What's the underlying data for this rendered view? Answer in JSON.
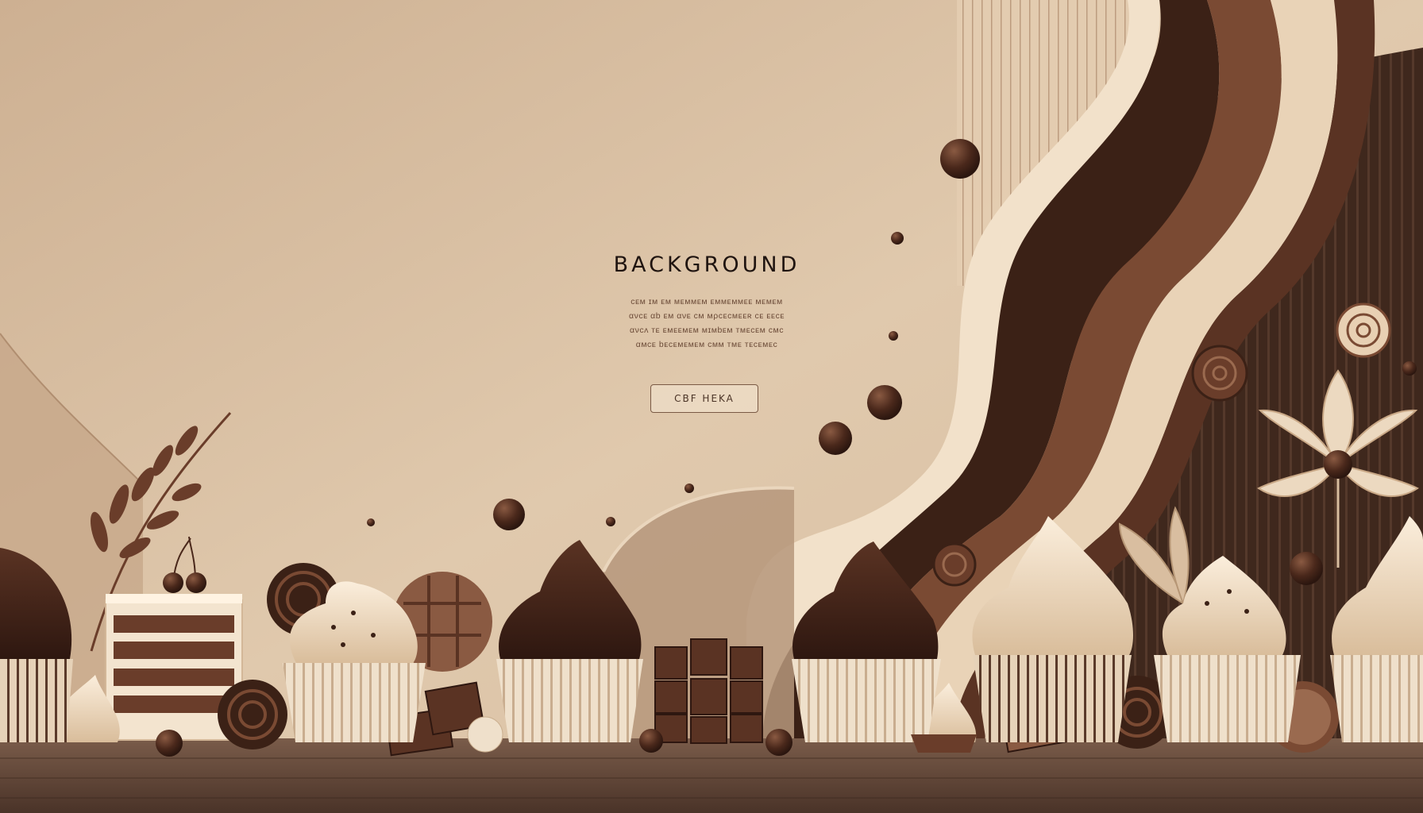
{
  "hero": {
    "title": "BACKGROUND",
    "body_lines": [
      "ᴄᴇᴍ ɪᴍ ᴇᴍ ᴍᴇᴍᴍᴇᴍ ᴇᴍᴍᴇᴍᴍᴇᴇ ᴍᴇᴍᴇᴍ",
      "ανᴄᴇ αb ᴇᴍ ανᴇ ᴄᴍ ᴍρᴄᴇᴄᴍᴇᴇʀ ᴄᴇ ᴇᴇᴄᴇ",
      "ανᴄʌ ᴛᴇ ᴇᴍᴇᴇᴍᴇᴍ ᴍɪᴍbᴇᴍ ᴛᴍᴇᴄᴇᴍ ᴄᴍᴄ",
      "αᴍᴄᴇ bᴇᴄᴇᴍᴇᴍᴇᴍ ᴄᴍᴍ ᴛᴍᴇ ᴛᴇᴄᴇᴍᴇᴄ"
    ],
    "button_label": "CBF HEKA"
  },
  "colors": {
    "background": "#d9c2a6",
    "cream": "#f0dcc3",
    "dark_chocolate": "#3b2116",
    "milk_chocolate": "#7a4a33",
    "wood": "#5e4436"
  },
  "icons": [
    "chocolate-ball-icon",
    "flower-icon",
    "leaf-icon",
    "cupcake-icon",
    "cookie-icon",
    "chocolate-block-icon",
    "cake-slice-icon",
    "cherry-icon",
    "spiral-candy-icon"
  ]
}
